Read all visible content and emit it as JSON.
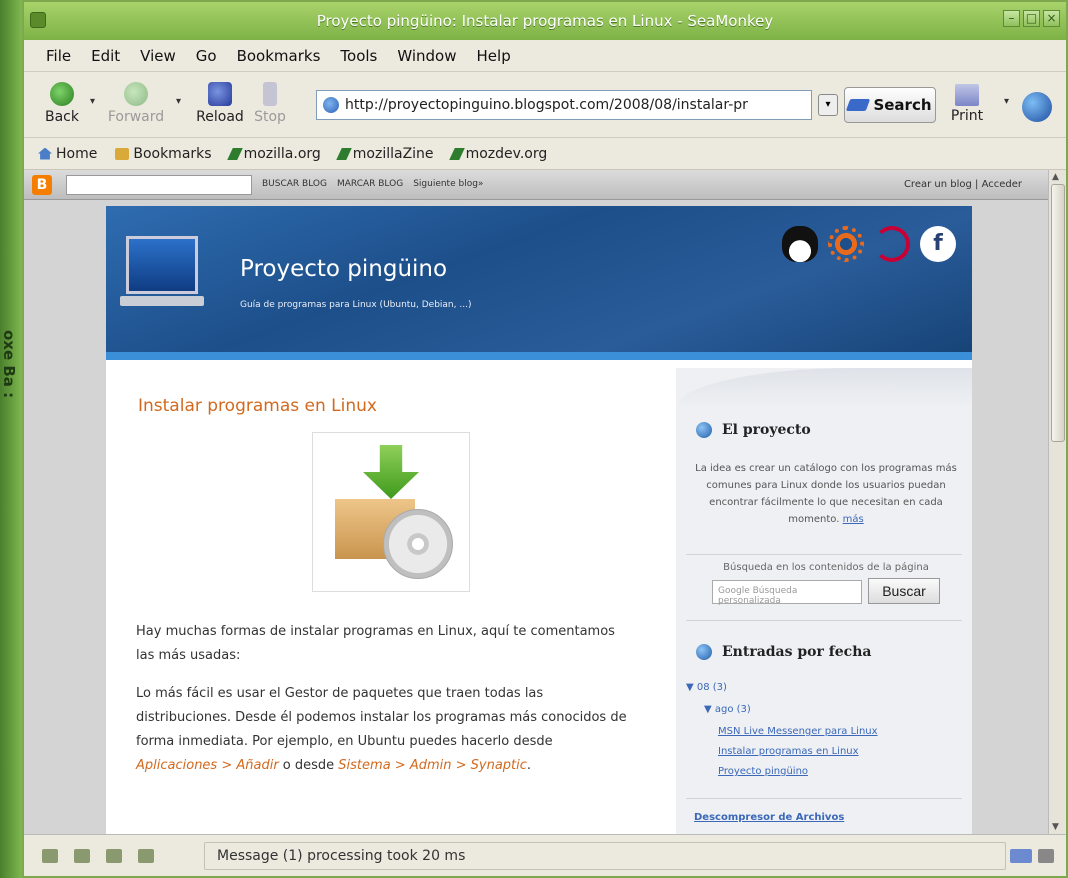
{
  "window": {
    "title": "Proyecto pingüino: Instalar programas en Linux - SeaMonkey"
  },
  "menubar": [
    "File",
    "Edit",
    "View",
    "Go",
    "Bookmarks",
    "Tools",
    "Window",
    "Help"
  ],
  "nav": {
    "back": "Back",
    "forward": "Forward",
    "reload": "Reload",
    "stop": "Stop",
    "url": "http://proyectopinguino.blogspot.com/2008/08/instalar-pr",
    "search": "Search",
    "print": "Print"
  },
  "bookmarks_bar": [
    "Home",
    "Bookmarks",
    "mozilla.org",
    "mozillaZine",
    "mozdev.org"
  ],
  "blogger_bar": {
    "logo": "B",
    "links": [
      "BUSCAR BLOG",
      "MARCAR BLOG",
      "Siguiente blog»"
    ],
    "right": "Crear un blog | Acceder"
  },
  "blog": {
    "title": "Proyecto pingüino",
    "description": "Guía de programas para Linux (Ubuntu, Debian, ...)",
    "fedora_glyph": "f"
  },
  "post": {
    "title": "Instalar programas en Linux",
    "p1": "Hay muchas formas de instalar programas en Linux, aquí te comentamos las más usadas:",
    "p2_before": "Lo más fácil es usar el Gestor de paquetes que traen todas las distribuciones. Desde él podemos instalar los programas más conocidos de forma inmediata. Por ejemplo, en Ubuntu puedes hacerlo desde ",
    "p2_path1": "Aplicaciones > Añadir",
    "p2_mid": " o desde ",
    "p2_path2": "Sistema > Admin > Synaptic",
    "p2_after": "."
  },
  "sidebar": {
    "proyecto_heading": "El proyecto",
    "proyecto_text": "La idea es crear un catálogo con los programas más comunes para Linux donde los usuarios puedan encontrar fácilmente lo que necesitan en cada momento.",
    "proyecto_more": "más",
    "search_label": "Búsqueda en los contenidos de la página",
    "search_placeholder": "Google   Búsqueda personalizada",
    "search_button": "Buscar",
    "entradas_heading": "Entradas por fecha",
    "year": "▼ 08 (3)",
    "month": "▼ ago (3)",
    "entries": [
      "MSN Live Messenger para Linux",
      "Instalar programas en Linux",
      "Proyecto pingüino"
    ],
    "bottom_link": "Descompresor de Archivos"
  },
  "status": {
    "message": "Message (1) processing took 20 ms"
  },
  "desktop": {
    "side_text": "oxe Ba :"
  }
}
